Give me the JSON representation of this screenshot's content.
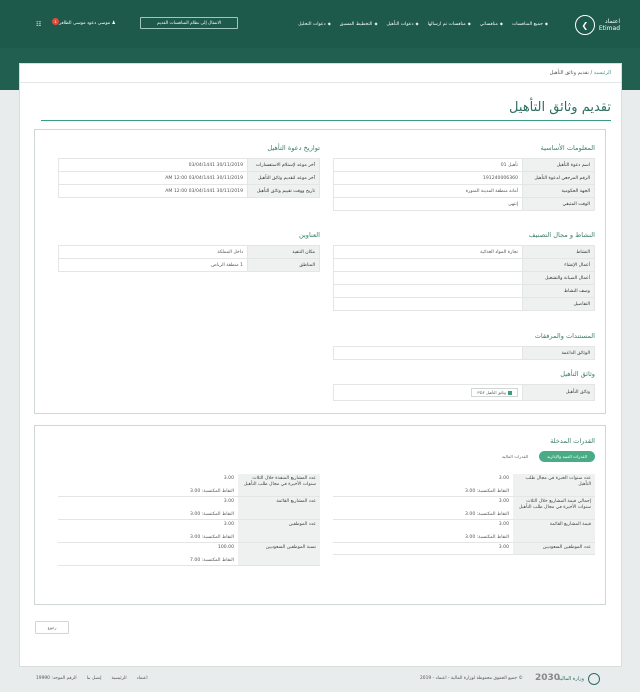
{
  "header": {
    "logo_main": "اعتماد",
    "logo_sub": "Etimad",
    "nav": [
      "جميع المنافسات",
      "منافساتي",
      "منافسات تم ارسالها",
      "دعوات التأهيل",
      "التخطيط المسبق",
      "دعوات التحليل"
    ],
    "portal_btn": "الانتقال إلى نظام المنافسات القديم",
    "user": "موسى دعود موسى الظافر",
    "notif_count": "1",
    "grid_icon": "grid-icon"
  },
  "breadcrumb": {
    "home": "الرئيسية",
    "sep": "/",
    "current": "تقديم وثائق التأهيل"
  },
  "page_title": "تقديم وثائق التأهيل",
  "basic": {
    "title": "المعلومات الأساسية",
    "rows": [
      {
        "label": "اسم دعوة التأهيل",
        "value": "تأهيل 01"
      },
      {
        "label": "الرقم المرجعي لدعوة التأهيل",
        "value": "191240006360"
      },
      {
        "label": "الجهة الحكومية",
        "value": "أمانة منطقة المدينة المنورة"
      },
      {
        "label": "الوقت المتبقي",
        "value": "إنتهى"
      }
    ]
  },
  "dates": {
    "title": "تواريخ دعوة التأهيل",
    "rows": [
      {
        "label": "آخر موعد لإستلام الاستفسارات",
        "value": "30/11/2019    03/04/1441"
      },
      {
        "label": "آخر موعد لتقديم وثائق التأهيل",
        "value": "30/11/2019    03/04/1441    12:00 AM"
      },
      {
        "label": "تاريخ ووقت تقييم وثائق التأهيل",
        "value": "30/11/2019    03/04/1441    12:00 AM"
      }
    ]
  },
  "activity": {
    "title": "النشاط و مجال التصنيف",
    "rows": [
      {
        "label": "النشاط",
        "value": "تجارة المواد الغذائية"
      },
      {
        "label": "أعمال الإنشاء",
        "value": ""
      },
      {
        "label": "أعمال الصيانة والتشغيل",
        "value": ""
      },
      {
        "label": "وصف النشاط",
        "value": ""
      },
      {
        "label": "التفاصيل",
        "value": ""
      }
    ]
  },
  "addresses": {
    "title": "العناوين",
    "rows": [
      {
        "label": "مكان التنفيذ",
        "value": "داخل المملكة"
      },
      {
        "label": "المناطق",
        "value": "1  منطقة الرياض"
      }
    ]
  },
  "documents": {
    "title": "المستندات والمرفقات",
    "rows": [
      {
        "label": "الوثائق الداعمة",
        "value": ""
      }
    ]
  },
  "qual_docs": {
    "title": "وثائق التأهيل",
    "label": "وثائق التأهيل",
    "btn": "وثائق التأهيل PDF"
  },
  "capabilities": {
    "title": "القدرات المدخلة",
    "tabs": [
      "القدرات الفنية والإدارية",
      "القدرات المالية"
    ],
    "right": [
      {
        "label": "عدد سنوات الخبرة في مجال طلب التأهيل",
        "value": "3.00",
        "points": "النقاط المكتسبة: 3.00"
      },
      {
        "label": "إجمالي قيمة المشاريع خلال الثلاث سنوات الأخيرة في مجال طلب التأهيل",
        "value": "3.00",
        "points": "النقاط المكتسبة: 3.00"
      },
      {
        "label": "قيمة المشاريع القائمة",
        "value": "3.00",
        "points": "النقاط المكتسبة: 3.00"
      },
      {
        "label": "عدد الموظفين السعوديين",
        "value": "3.00",
        "points": ""
      }
    ],
    "left": [
      {
        "label": "عدد المشاريع المنفذة خلال الثلاث سنوات الأخيرة في مجال طلب التأهيل",
        "value": "3.00",
        "points": "النقاط المكتسبة: 3.00"
      },
      {
        "label": "عدد المشاريع القائمة",
        "value": "3.00",
        "points": "النقاط المكتسبة: 3.00"
      },
      {
        "label": "عدد الموظفين",
        "value": "3.00",
        "points": "النقاط المكتسبة: 3.00"
      },
      {
        "label": "نسبة الموظفين السعوديين",
        "value": "100.00",
        "points": "النقاط المكتسبة: 7.00"
      }
    ]
  },
  "back_btn": "رجوع",
  "footer": {
    "ministry": "وزارة المالية",
    "vision": "2030",
    "copyright": "© جميع الحقوق محفوظة لوزارة المالية - اعتماد - 2019",
    "links": [
      "اعتماد",
      "الرئيسية",
      "إتصل بنا",
      "الرقم الموحد: 19990"
    ]
  }
}
